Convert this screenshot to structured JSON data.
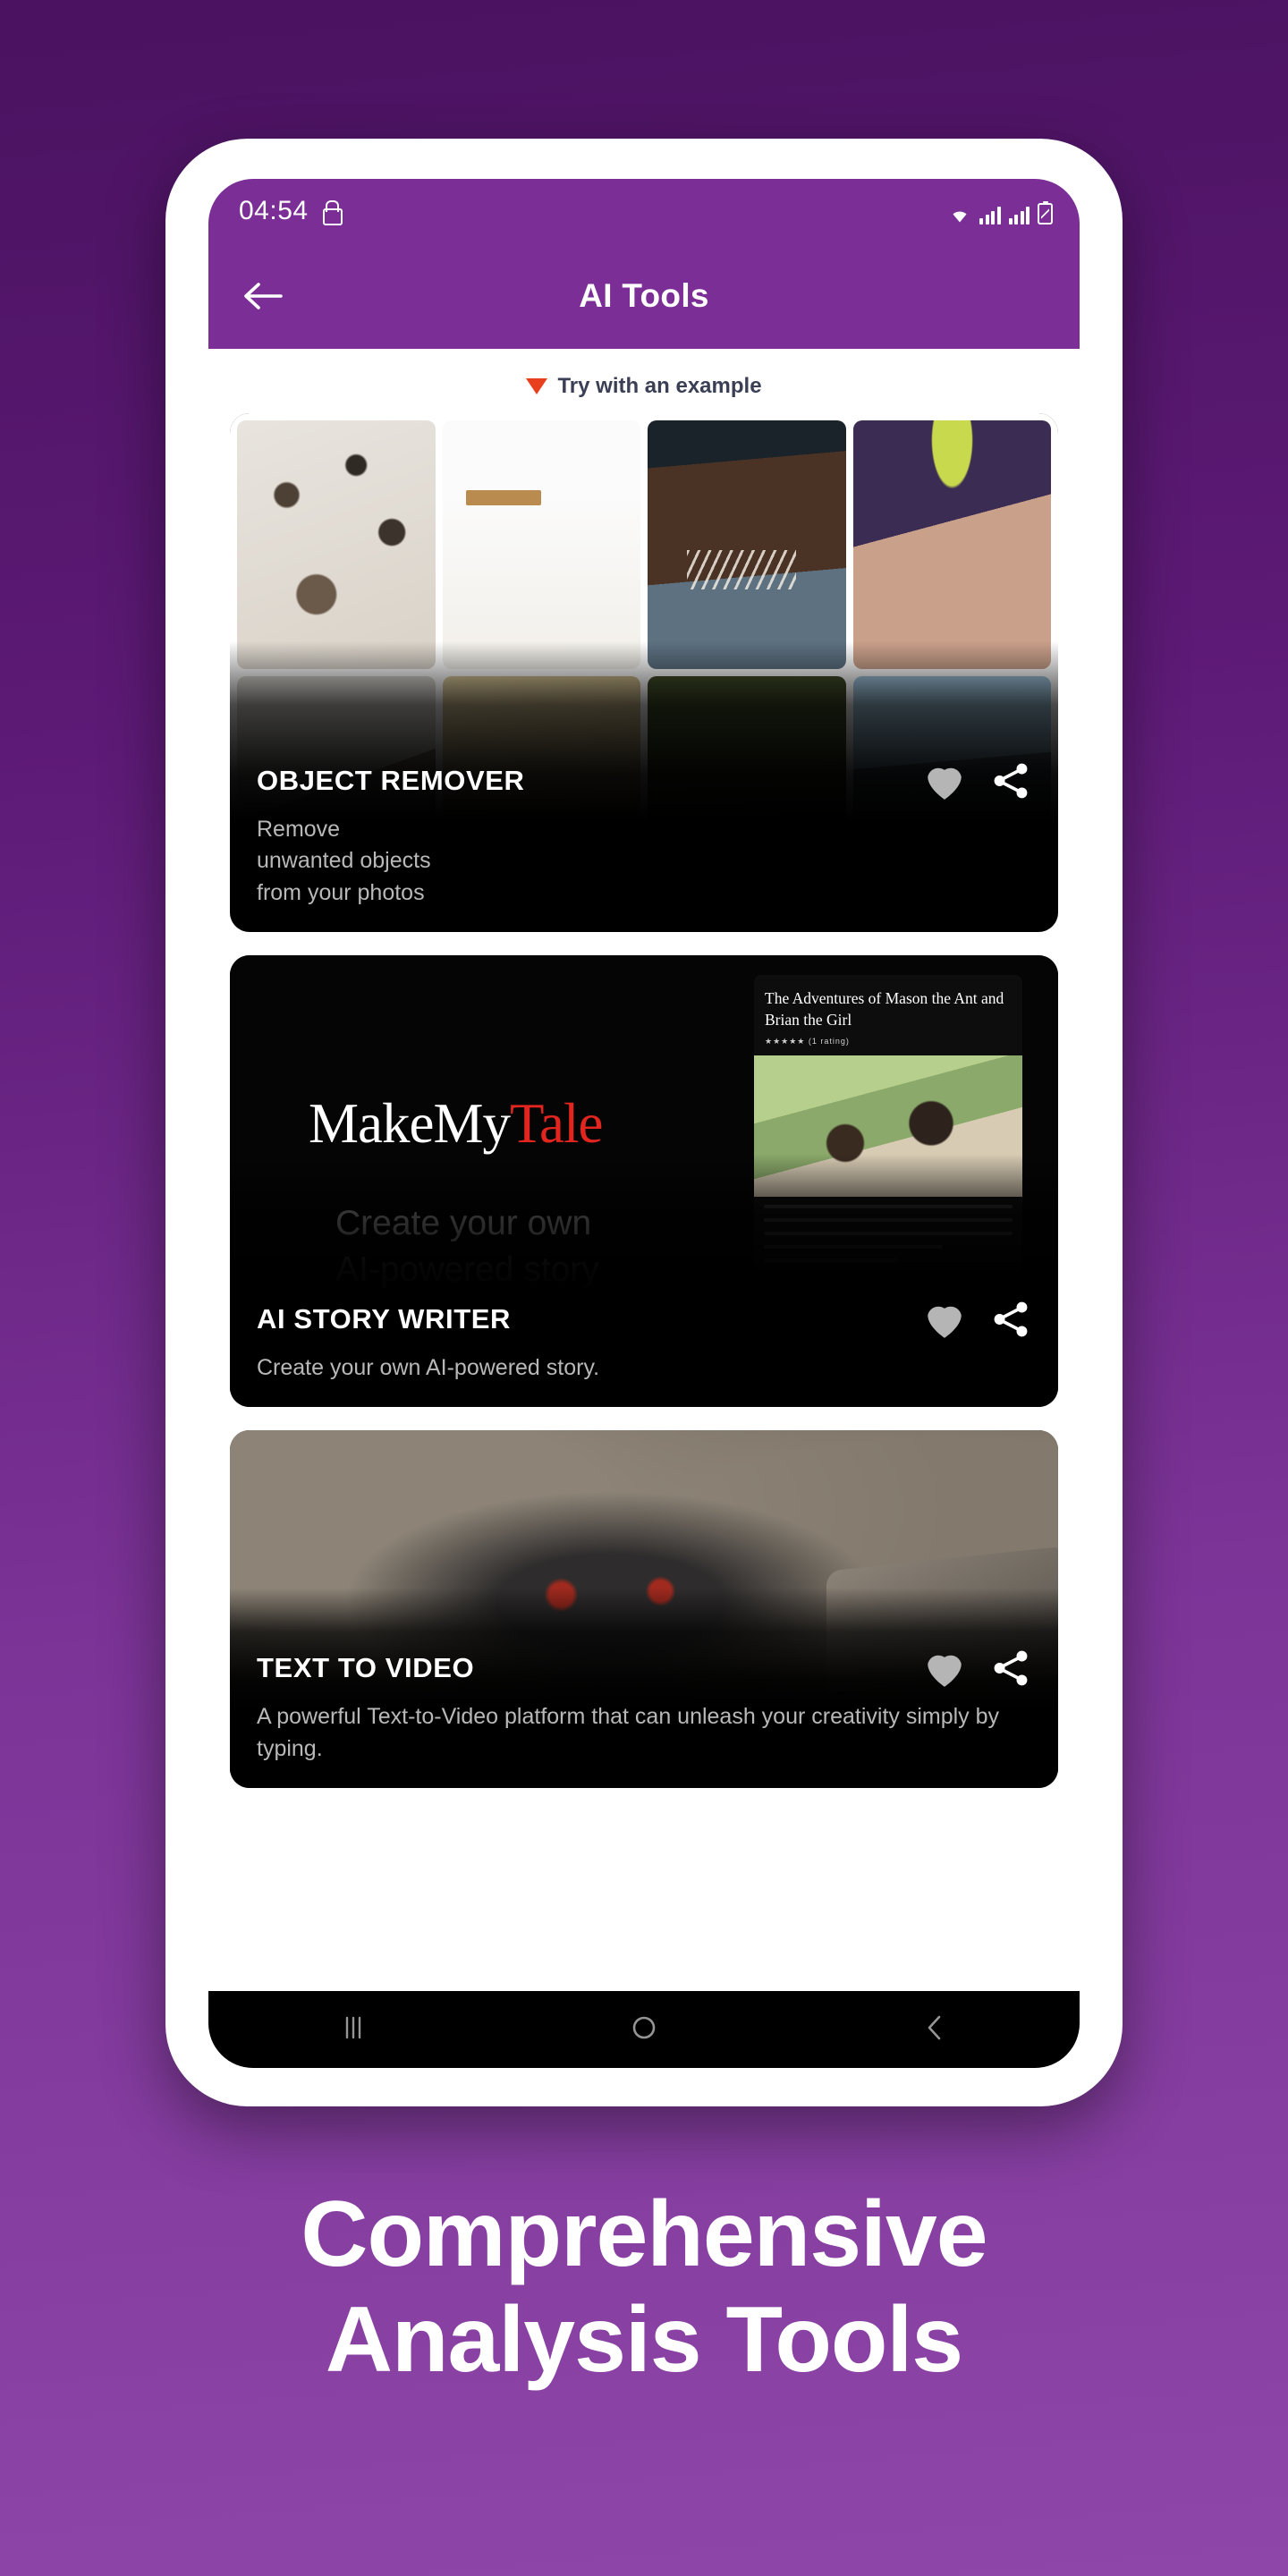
{
  "status_bar": {
    "time": "04:54",
    "lock_icon": "lock-icon",
    "wifi_icon": "wifi-icon",
    "signal_icon_1": "signal-bars-icon",
    "signal_icon_2": "signal-bars-icon",
    "battery_icon": "battery-icon"
  },
  "app_bar": {
    "back_icon": "back-arrow-icon",
    "title": "AI Tools"
  },
  "try_banner": {
    "marker_icon": "red-triangle-down-icon",
    "label": "Try with an example"
  },
  "cards": [
    {
      "id": "object-remover",
      "title": "OBJECT REMOVER",
      "description": "Remove\nunwanted objects\nfrom your photos",
      "description_lines": [
        "Remove",
        "unwanted objects",
        "from your photos"
      ],
      "favorite_icon": "heart-icon",
      "favorite_state": "off",
      "share_icon": "share-icon",
      "thumbnail_count": 8
    },
    {
      "id": "ai-story-writer",
      "title": "AI STORY WRITER",
      "description": "Create your own AI-powered story.",
      "favorite_icon": "heart-icon",
      "favorite_state": "off",
      "share_icon": "share-icon",
      "preview": {
        "logo_part1": "MakeMy",
        "logo_part2": "Tale",
        "tagline_line1": "Create your own",
        "tagline_line2": "AI-powered story",
        "book_title": "The Adventures of Mason the Ant and Brian the Girl",
        "book_rating": "★★★★★ (1 rating)"
      }
    },
    {
      "id": "text-to-video",
      "title": "TEXT TO VIDEO",
      "description": "A powerful Text-to-Video platform that can unleash your creativity simply by typing.",
      "favorite_icon": "heart-icon",
      "favorite_state": "on",
      "share_icon": "share-icon"
    }
  ],
  "system_nav": {
    "recents_icon": "recents-icon",
    "home_icon": "home-icon",
    "back_icon": "back-icon"
  },
  "headline": {
    "line1": "Comprehensive",
    "line2": "Analysis Tools"
  },
  "colors": {
    "background_top": "#4a1260",
    "background_bottom": "#8e46a8",
    "app_bar": "#7b2e96",
    "accent_red": "#e8401f",
    "card_bg": "#000000",
    "logo_red": "#e2251f",
    "text_muted": "#b8b8b8"
  }
}
